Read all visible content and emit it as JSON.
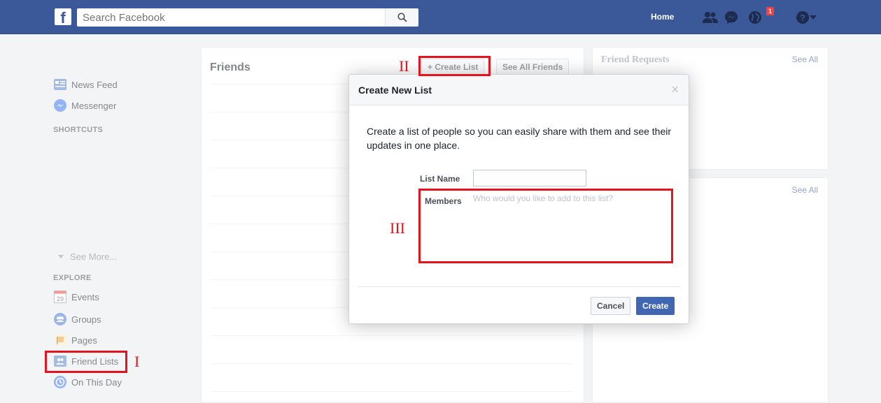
{
  "topbar": {
    "logo_letter": "f",
    "search_placeholder": "Search Facebook",
    "home_label": "Home",
    "notification_count": "1",
    "icons": [
      "facebook-logo-icon",
      "search-icon",
      "friend-requests-icon",
      "messenger-icon",
      "notifications-globe-icon",
      "help-icon",
      "caret-down-icon"
    ]
  },
  "leftnav": {
    "items_top": [
      {
        "label": "News Feed",
        "icon": "news-feed-icon"
      },
      {
        "label": "Messenger",
        "icon": "messenger-icon"
      }
    ],
    "shortcuts_heading": "SHORTCUTS",
    "see_more": "See More...",
    "explore_heading": "EXPLORE",
    "items_explore": [
      {
        "label": "Events",
        "icon": "calendar-icon",
        "calendar_day": "29"
      },
      {
        "label": "Groups",
        "icon": "groups-icon"
      },
      {
        "label": "Pages",
        "icon": "flag-icon"
      },
      {
        "label": "Friend Lists",
        "icon": "friend-lists-icon"
      },
      {
        "label": "On This Day",
        "icon": "history-clock-icon"
      }
    ]
  },
  "friends_panel": {
    "title": "Friends",
    "create_list_button": "+ Create List",
    "see_all_friends_button": "See All Friends"
  },
  "right_panels": {
    "friend_requests_title": "Friend Requests",
    "see_all_1": "See All",
    "see_all_2": "See All"
  },
  "modal": {
    "title": "Create New List",
    "close_glyph": "×",
    "description": "Create a list of people so you can easily share with them and see their updates in one place.",
    "list_name_label": "List Name",
    "list_name_value": "",
    "members_label": "Members",
    "members_placeholder": "Who would you like to add to this list?",
    "cancel_button": "Cancel",
    "create_button": "Create"
  },
  "annotations": {
    "marker_1": "I",
    "marker_2": "II",
    "marker_3": "III",
    "highlight_color": "#e3141d"
  },
  "colors": {
    "brand_blue": "#3b5998",
    "button_blue": "#4267b2",
    "page_bg": "#e9ebee"
  }
}
